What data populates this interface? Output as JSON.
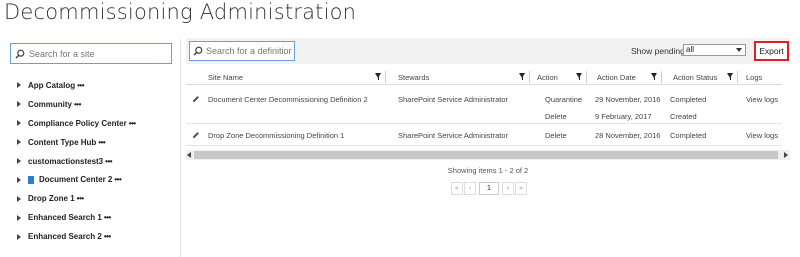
{
  "page_title": "Decommissioning Administration",
  "sidebar": {
    "search_placeholder": "Search for a site",
    "items": [
      {
        "label": "App Catalog",
        "more": "•••",
        "has_icon": false
      },
      {
        "label": "Community",
        "more": "•••",
        "has_icon": false
      },
      {
        "label": "Compliance Policy Center",
        "more": "•••",
        "has_icon": false
      },
      {
        "label": "Content Type Hub",
        "more": "•••",
        "has_icon": false
      },
      {
        "label": "customactionstest3",
        "more": "•••",
        "has_icon": false
      },
      {
        "label": "Document Center 2",
        "more": "•••",
        "has_icon": true
      },
      {
        "label": "Drop Zone 1",
        "more": "•••",
        "has_icon": false
      },
      {
        "label": "Enhanced Search 1",
        "more": "•••",
        "has_icon": false
      },
      {
        "label": "Enhanced Search 2",
        "more": "•••",
        "has_icon": false
      }
    ]
  },
  "toolbar": {
    "search_placeholder": "Search for a definition",
    "show_pending_label": "Show pending",
    "show_pending_value": "all",
    "export_label": "Export"
  },
  "grid": {
    "columns": [
      "Site Name",
      "Stewards",
      "Action",
      "Action Date",
      "Action Status",
      "Logs"
    ],
    "rows": [
      {
        "site_name": "Document Center Decommissioning Definition 2",
        "stewards": "SharePoint Service Administrator",
        "actions": [
          "Quarantine",
          "Delete"
        ],
        "dates": [
          "29 November, 2016",
          "9 February, 2017"
        ],
        "statuses": [
          "Completed",
          "Created"
        ],
        "logs": "View logs"
      },
      {
        "site_name": "Drop Zone Decommissioning Definition 1",
        "stewards": "SharePoint Service Administrator",
        "actions": [
          "Delete"
        ],
        "dates": [
          "28 November, 2016"
        ],
        "statuses": [
          "Completed"
        ],
        "logs": "View logs"
      }
    ]
  },
  "footer": {
    "showing_text": "Showing items 1 - 2 of 2",
    "pager": {
      "first": "«",
      "prev": "‹",
      "current_page": "1",
      "next": "›",
      "last": "»"
    }
  },
  "colors": {
    "accent_border": "#6aa0d8",
    "export_highlight": "#e02020",
    "doc_icon": "#2b7cd3"
  }
}
